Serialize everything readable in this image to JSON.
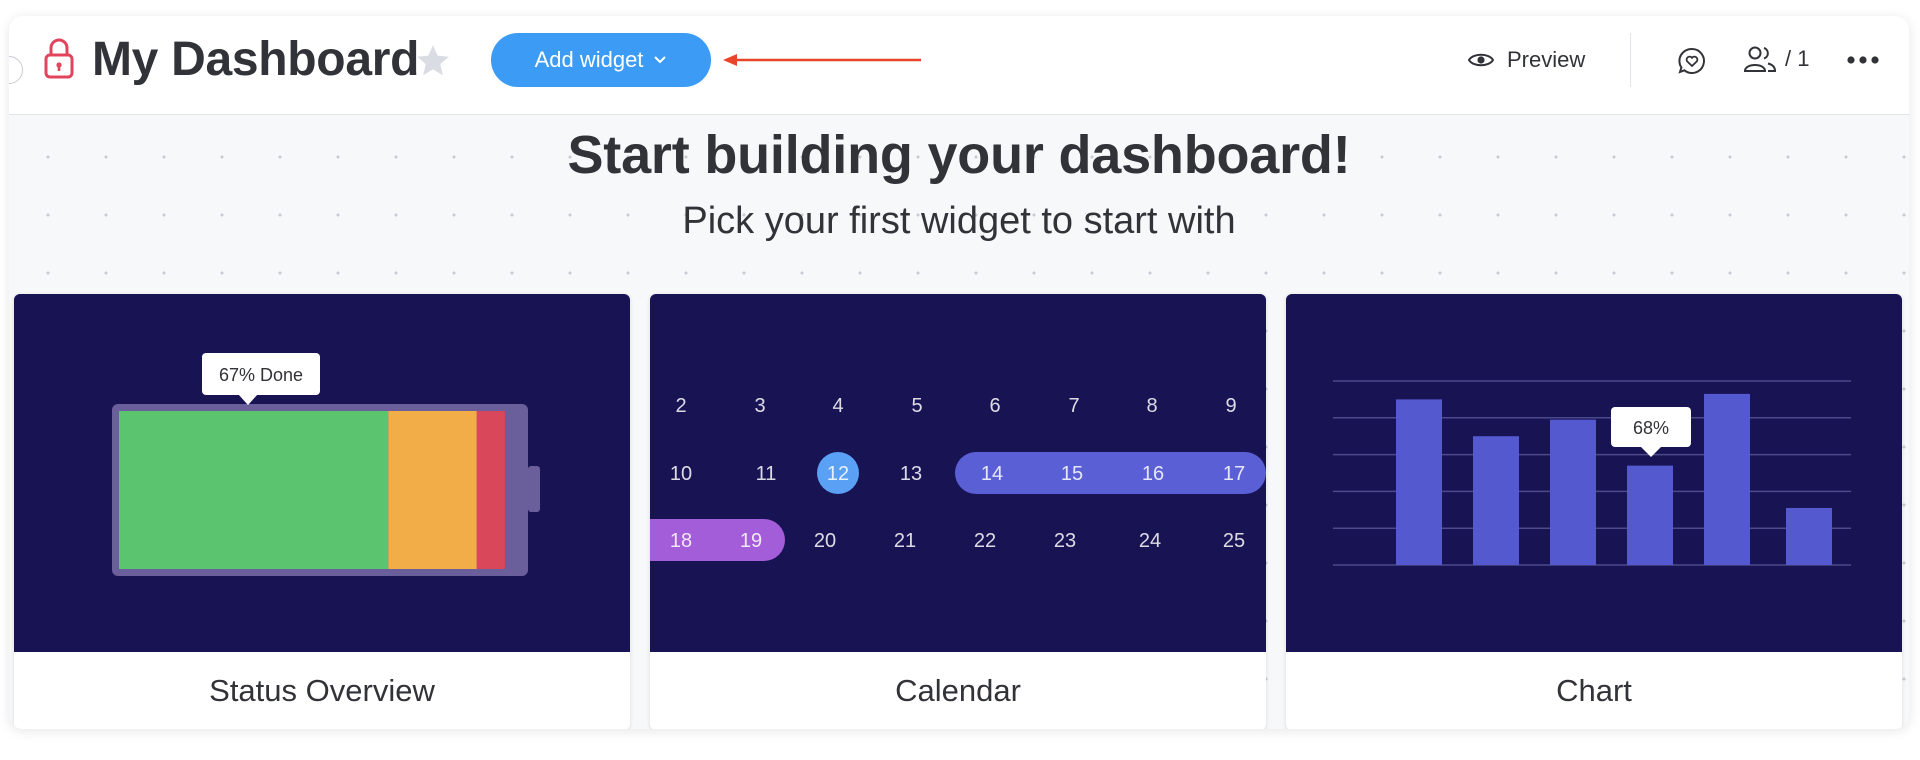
{
  "header": {
    "title": "My Dashboard",
    "add_widget_label": "Add widget",
    "preview_label": "Preview",
    "members_count": "/ 1"
  },
  "hero": {
    "title": "Start building your dashboard!",
    "subtitle": "Pick your first widget to start with"
  },
  "widgets": [
    {
      "label": "Status Overview",
      "tooltip": "67% Done",
      "segments": [
        {
          "status": "done",
          "fraction": 0.67,
          "color": "#5ac46e"
        },
        {
          "status": "working",
          "fraction": 0.22,
          "color": "#f2ad48"
        },
        {
          "status": "stuck",
          "fraction": 0.07,
          "color": "#d9475b"
        }
      ]
    },
    {
      "label": "Calendar",
      "weeks": [
        [
          "2",
          "3",
          "4",
          "5",
          "6",
          "7",
          "8",
          "9"
        ],
        [
          "10",
          "11",
          "12",
          "13",
          "14",
          "15",
          "16",
          "17"
        ],
        [
          "18",
          "19",
          "20",
          "21",
          "22",
          "23",
          "24",
          "25"
        ]
      ],
      "today": "12",
      "range_blue": [
        "14",
        "17"
      ],
      "range_purple": [
        "18",
        "19"
      ]
    },
    {
      "label": "Chart",
      "tooltip": "68%",
      "highlight_index": 3,
      "bar_values": [
        0.9,
        0.7,
        0.79,
        0.54,
        0.93,
        0.31
      ]
    }
  ],
  "colors": {
    "accent": "#3b9bf5",
    "annotation_arrow": "#e8452c",
    "lock": "#e2445c",
    "widget_background": "#181353",
    "calendar_blue": "#5a5fd6",
    "calendar_today": "#5aa0f5",
    "calendar_purple": "#a45dd8",
    "chart_bar": "#5559d0"
  },
  "icons": {
    "lock": "lock-icon",
    "favorite": "star-icon",
    "dropdown": "chevron-down-icon",
    "preview": "eye-icon",
    "updates": "chat-heart-icon",
    "members": "people-icon",
    "more": "more-icon"
  }
}
